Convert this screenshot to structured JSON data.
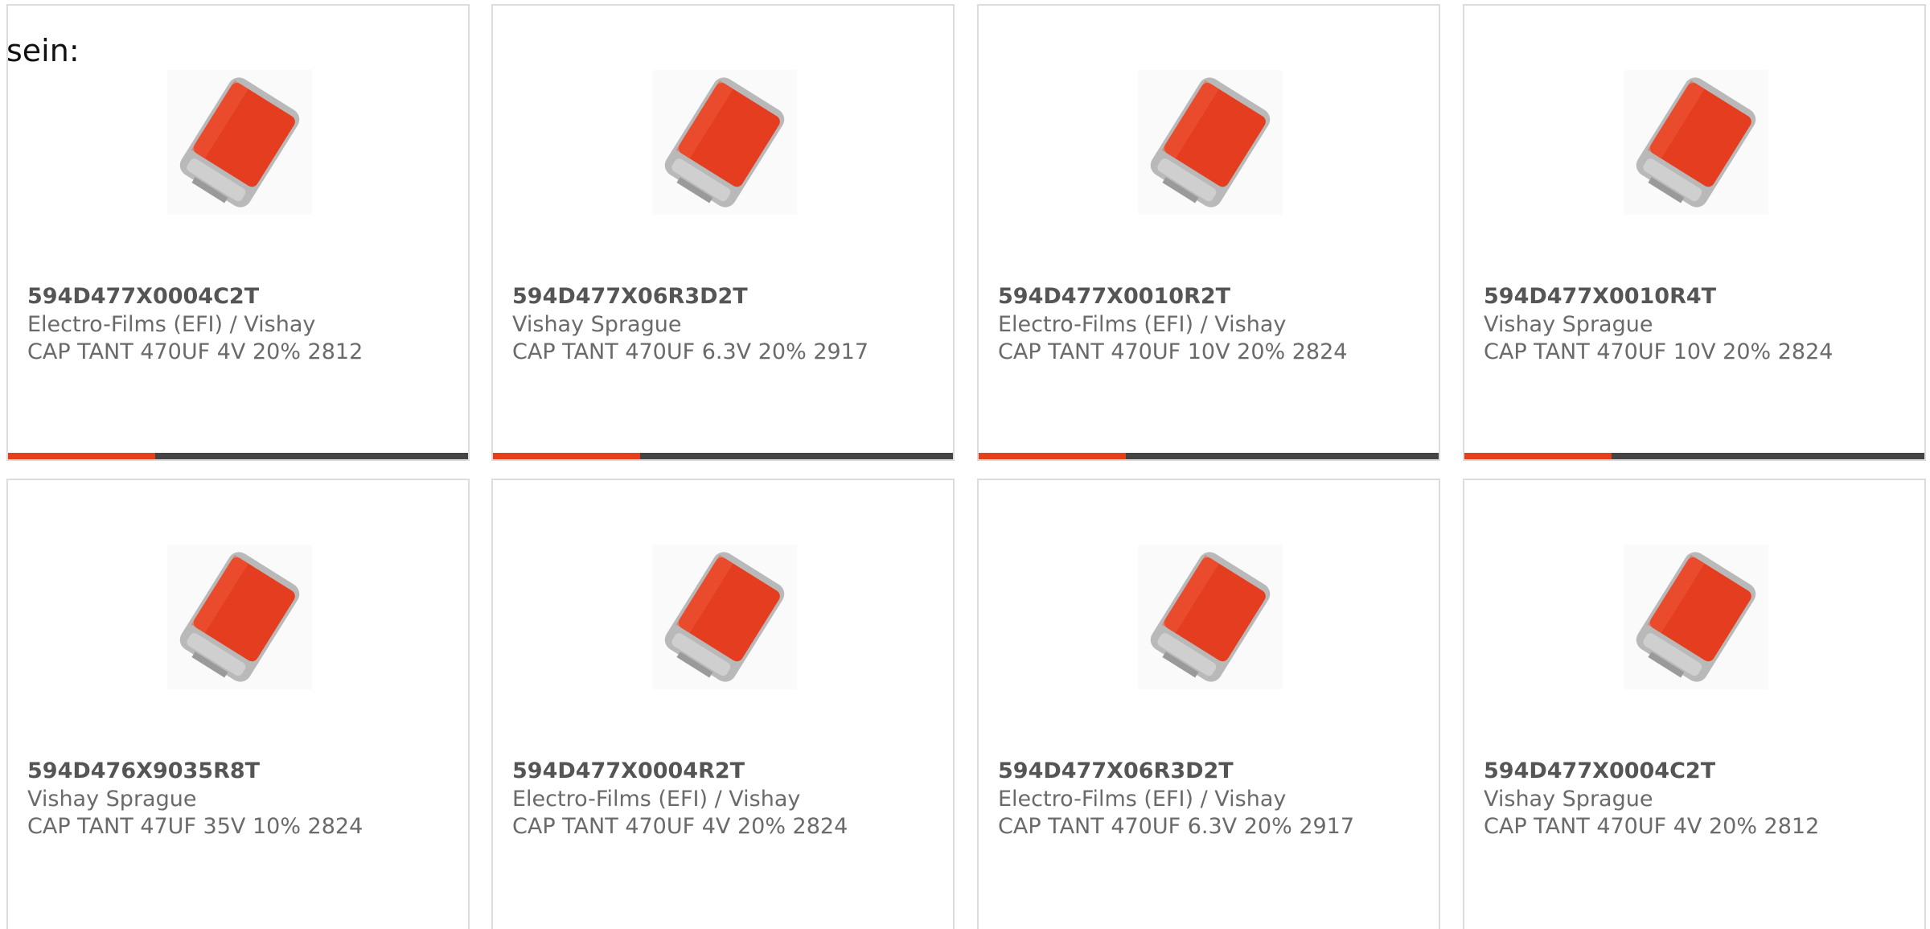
{
  "intro_text": "sein:",
  "colors": {
    "accent": "#e5401a",
    "bar_track": "#444444",
    "card_border": "#dcdcdc",
    "capacitor_body": "#e43d1f",
    "terminal": "#b9b9b9"
  },
  "products": [
    {
      "part": "594D477X0004C2T",
      "manufacturer": "Electro-Films (EFI) / Vishay",
      "description": "CAP TANT 470UF 4V 20% 2812",
      "image_icon": "tantalum-capacitor-icon",
      "progress": 0.32
    },
    {
      "part": "594D477X06R3D2T",
      "manufacturer": "Vishay Sprague",
      "description": "CAP TANT 470UF 6.3V 20% 2917",
      "image_icon": "tantalum-capacitor-icon",
      "progress": 0.32
    },
    {
      "part": "594D477X0010R2T",
      "manufacturer": "Electro-Films (EFI) / Vishay",
      "description": "CAP TANT 470UF 10V 20% 2824",
      "image_icon": "tantalum-capacitor-icon",
      "progress": 0.32
    },
    {
      "part": "594D477X0010R4T",
      "manufacturer": "Vishay Sprague",
      "description": "CAP TANT 470UF 10V 20% 2824",
      "image_icon": "tantalum-capacitor-icon",
      "progress": 0.32
    },
    {
      "part": "594D476X9035R8T",
      "manufacturer": "Vishay Sprague",
      "description": "CAP TANT 47UF 35V 10% 2824",
      "image_icon": "tantalum-capacitor-icon"
    },
    {
      "part": "594D477X0004R2T",
      "manufacturer": "Electro-Films (EFI) / Vishay",
      "description": "CAP TANT 470UF 4V 20% 2824",
      "image_icon": "tantalum-capacitor-icon"
    },
    {
      "part": "594D477X06R3D2T",
      "manufacturer": "Electro-Films (EFI) / Vishay",
      "description": "CAP TANT 470UF 6.3V 20% 2917",
      "image_icon": "tantalum-capacitor-icon"
    },
    {
      "part": "594D477X0004C2T",
      "manufacturer": "Vishay Sprague",
      "description": "CAP TANT 470UF 4V 20% 2812",
      "image_icon": "tantalum-capacitor-icon"
    }
  ]
}
